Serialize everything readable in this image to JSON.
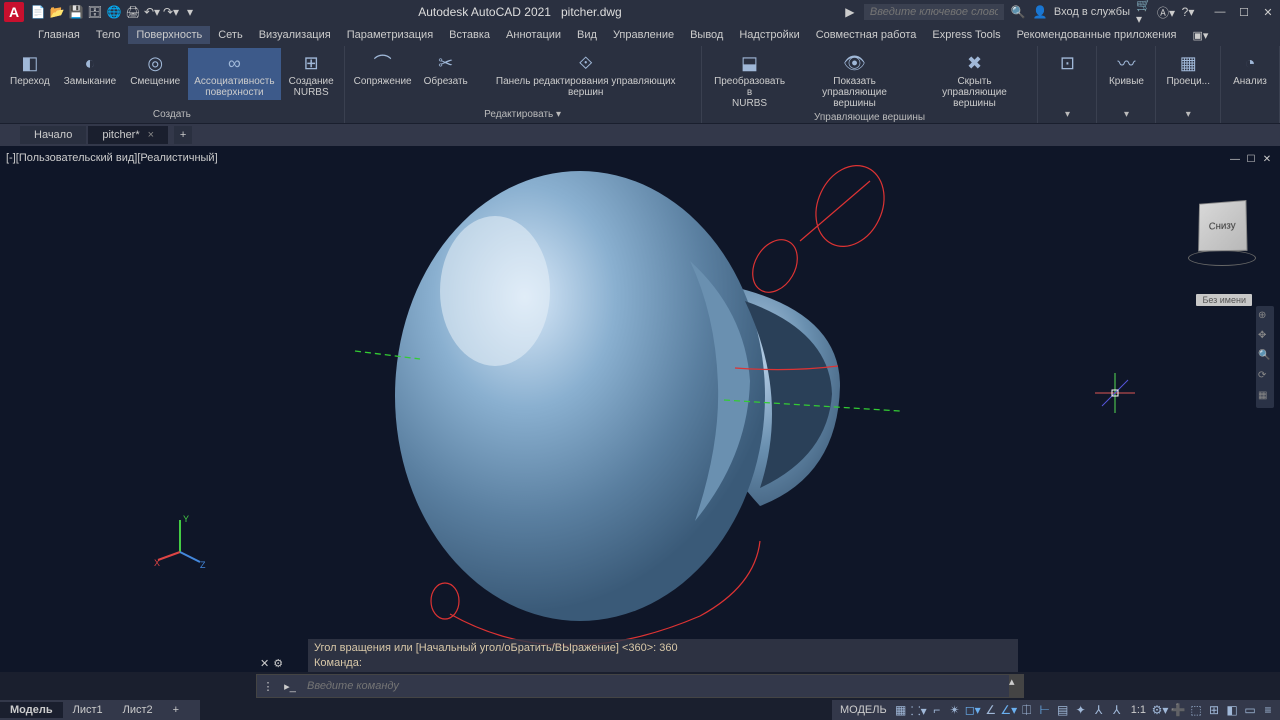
{
  "title": {
    "app": "Autodesk AutoCAD 2021",
    "file": "pitcher.dwg"
  },
  "search": {
    "placeholder": "Введите ключевое слово/фразу"
  },
  "user": {
    "login": "Вход в службы"
  },
  "menu": {
    "items": [
      "Главная",
      "Тело",
      "Поверхность",
      "Сеть",
      "Визуализация",
      "Параметризация",
      "Вставка",
      "Аннотации",
      "Вид",
      "Управление",
      "Вывод",
      "Надстройки",
      "Совместная работа",
      "Express Tools",
      "Рекомендованные приложения"
    ],
    "active": 2
  },
  "ribbon": {
    "groups": [
      {
        "title": "Создать",
        "items": [
          {
            "label": "Переход"
          },
          {
            "label": "Замыкание"
          },
          {
            "label": "Смещение"
          },
          {
            "label": "Ассоциативность\nповерхности",
            "hl": true
          },
          {
            "label": "Создание\nNURBS"
          }
        ]
      },
      {
        "title": "Редактировать ▾",
        "items": [
          {
            "label": "Сопряжение"
          },
          {
            "label": "Обрезать"
          },
          {
            "label": "Панель редактирования управляющих вершин",
            "wide": true
          }
        ]
      },
      {
        "title": "Управляющие вершины",
        "items": [
          {
            "label": "Преобразовать в\nNURBS"
          },
          {
            "label": "Показать\nуправляющие вершины"
          },
          {
            "label": "Скрыть\nуправляющие вершины"
          }
        ]
      },
      {
        "title": "▾",
        "items": [
          {
            "label": ""
          }
        ]
      },
      {
        "title": "▾",
        "items": [
          {
            "label": "Кривые"
          }
        ]
      },
      {
        "title": "▾",
        "items": [
          {
            "label": "Проеци..."
          }
        ]
      },
      {
        "title": "",
        "items": [
          {
            "label": "Анализ"
          }
        ]
      }
    ]
  },
  "tabs": {
    "start": "Начало",
    "file": "pitcher*"
  },
  "viewport": {
    "label": "[-][Пользовательский вид][Реалистичный]",
    "cube": "Снизу",
    "badge": "Без имени"
  },
  "cmd": {
    "history1": "Угол вращения или [Начальный угол/оБратить/ВЫражение] <360>: 360",
    "history2": "Команда:",
    "placeholder": "Введите команду"
  },
  "layouts": {
    "model": "Модель",
    "l1": "Лист1",
    "l2": "Лист2"
  },
  "status": {
    "model": "МОДЕЛЬ",
    "scale": "1:1"
  }
}
